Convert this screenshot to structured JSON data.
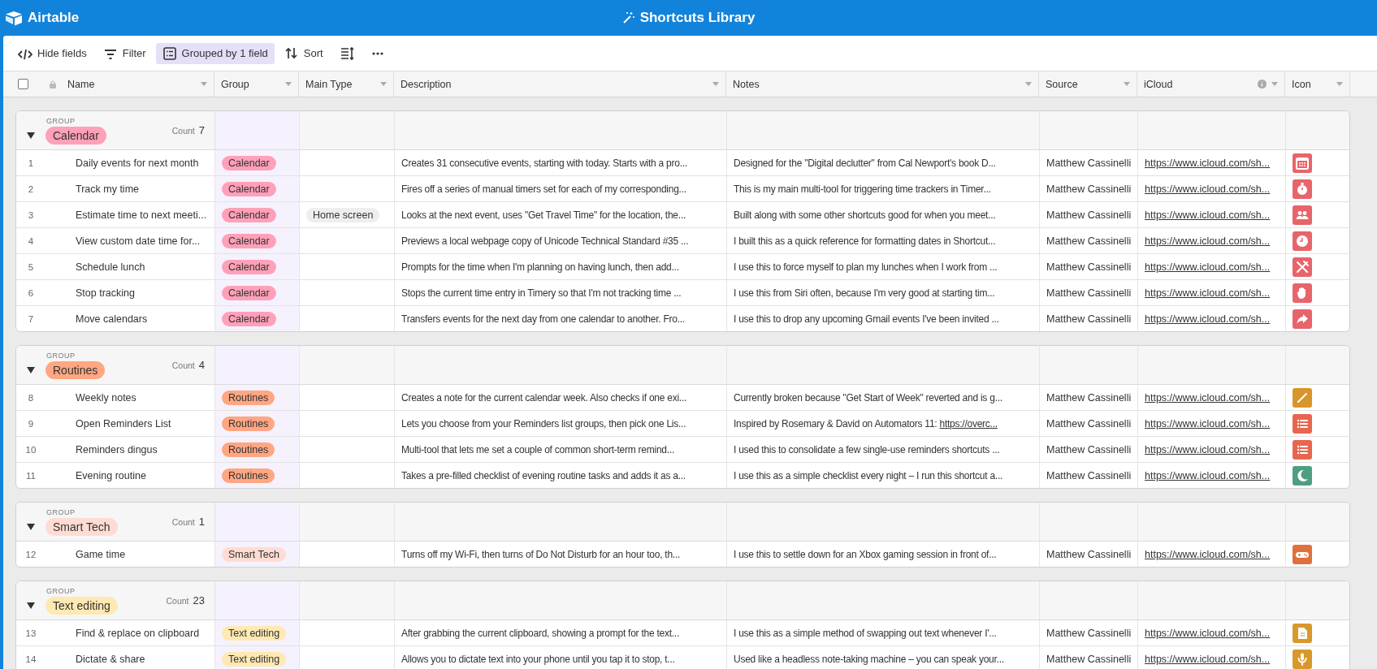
{
  "app": {
    "name": "Airtable"
  },
  "base": {
    "title": "Shortcuts Library"
  },
  "toolbar": [
    {
      "kind": "hide-fields",
      "label": "Hide fields",
      "selected": false
    },
    {
      "kind": "filter",
      "label": "Filter",
      "selected": false
    },
    {
      "kind": "group",
      "label": "Grouped by 1 field",
      "selected": true
    },
    {
      "kind": "sort",
      "label": "Sort",
      "selected": false
    },
    {
      "kind": "row-height",
      "selected": false
    },
    {
      "kind": "more",
      "selected": false
    }
  ],
  "table": {
    "select_all_checked": false,
    "columns": [
      {
        "label": "Name",
        "locked": true,
        "info": false
      },
      {
        "label": "Group",
        "locked": false,
        "info": false
      },
      {
        "label": "Main Type",
        "locked": false,
        "info": false
      },
      {
        "label": "Description",
        "locked": false,
        "info": false
      },
      {
        "label": "Notes",
        "locked": false,
        "info": false
      },
      {
        "label": "Source",
        "locked": false,
        "info": false
      },
      {
        "label": "iCloud",
        "locked": false,
        "info": true
      },
      {
        "label": "Icon",
        "locked": false,
        "info": false
      }
    ]
  },
  "groups": [
    {
      "label": "GROUP",
      "name": "Calendar",
      "color": "#ffa0b9",
      "count_label": "Count",
      "count": "7",
      "expanded": true,
      "rows": [
        {
          "number": "1",
          "name": "Daily events for next month",
          "group": "Calendar",
          "description": "Creates 31 consecutive events, starting with today. Starts with a pro...",
          "notes": "Designed for the \"Digital declutter\" from Cal Newport's book D...",
          "source": "Matthew Cassinelli",
          "icloud": "https://www.icloud.com/sh...",
          "icon": {
            "kind": "calendar",
            "color": "#e8646b"
          }
        },
        {
          "number": "2",
          "name": "Track my time",
          "group": "Calendar",
          "description": "Fires off a series of manual timers set for each of my corresponding...",
          "notes": "This is my main multi-tool for triggering time trackers in Timer...",
          "source": "Matthew Cassinelli",
          "icloud": "https://www.icloud.com/sh...",
          "icon": {
            "kind": "stopwatch",
            "color": "#e8646b"
          }
        },
        {
          "number": "3",
          "name": "Estimate time to next meeti...",
          "group": "Calendar",
          "main_type": "Home screen",
          "description": "Looks at the next event, uses \"Get Travel Time\" for the location, the...",
          "notes": "Built along with some other shortcuts good for when you meet...",
          "source": "Matthew Cassinelli",
          "icloud": "https://www.icloud.com/sh...",
          "icon": {
            "kind": "people",
            "color": "#e8646b"
          }
        },
        {
          "number": "4",
          "name": "View custom date time for...",
          "group": "Calendar",
          "description": "Previews a local webpage copy of Unicode Technical Standard #35 ...",
          "notes": "I built this as a quick reference for formatting dates in Shortcut...",
          "source": "Matthew Cassinelli",
          "icloud": "https://www.icloud.com/sh...",
          "icon": {
            "kind": "clock",
            "color": "#e8646b"
          }
        },
        {
          "number": "5",
          "name": "Schedule lunch",
          "group": "Calendar",
          "description": "Prompts for the time when I'm planning on having lunch, then add...",
          "notes": "I use this to force myself to plan my lunches when I work from ...",
          "source": "Matthew Cassinelli",
          "icloud": "https://www.icloud.com/sh...",
          "icon": {
            "kind": "utensils",
            "color": "#e8646b"
          }
        },
        {
          "number": "6",
          "name": "Stop tracking",
          "group": "Calendar",
          "description": "Stops the current time entry in Timery so that I'm not tracking time ...",
          "notes": "I use this from Siri often, because I'm very good at starting tim...",
          "source": "Matthew Cassinelli",
          "icloud": "https://www.icloud.com/sh...",
          "icon": {
            "kind": "hand",
            "color": "#e8646b"
          }
        },
        {
          "number": "7",
          "name": "Move calendars",
          "group": "Calendar",
          "description": "Transfers events for the next day from one calendar to another. Fro...",
          "notes": "I use this to drop any upcoming Gmail events I've been invited ...",
          "source": "Matthew Cassinelli",
          "icloud": "https://www.icloud.com/sh...",
          "icon": {
            "kind": "arrow",
            "color": "#e8646b"
          }
        }
      ]
    },
    {
      "label": "GROUP",
      "name": "Routines",
      "color": "#ffa682",
      "count_label": "Count",
      "count": "4",
      "expanded": true,
      "rows": [
        {
          "number": "8",
          "name": "Weekly notes",
          "group": "Routines",
          "description": "Creates a note for the current calendar week. Also checks if one exi...",
          "notes": "Currently broken because \"Get Start of Week\" reverted and is g...",
          "source": "Matthew Cassinelli",
          "icloud": "https://www.icloud.com/sh...",
          "icon": {
            "kind": "pencil",
            "color": "#d9952b"
          }
        },
        {
          "number": "9",
          "name": "Open Reminders List",
          "group": "Routines",
          "description": "Lets you choose from your Reminders list groups, then pick one Lis...",
          "notes": "Inspired by Rosemary & David on Automators 11: ",
          "notes_link": "https://overc...",
          "source": "Matthew Cassinelli",
          "icloud": "https://www.icloud.com/sh...",
          "icon": {
            "kind": "list",
            "color": "#e8664f"
          }
        },
        {
          "number": "10",
          "name": "Reminders dingus",
          "group": "Routines",
          "description": "Multi-tool that lets me set a couple of common short-term remind...",
          "notes": "I used this to consolidate a few single-use reminders shortcuts ...",
          "source": "Matthew Cassinelli",
          "icloud": "https://www.icloud.com/sh...",
          "icon": {
            "kind": "list",
            "color": "#e8664f"
          }
        },
        {
          "number": "11",
          "name": "Evening routine",
          "group": "Routines",
          "description": "Takes a pre-filled checklist of evening routine tasks and adds it as a...",
          "notes": "I use this as a simple checklist every night – I run this shortcut a...",
          "source": "Matthew Cassinelli",
          "icloud": "https://www.icloud.com/sh...",
          "icon": {
            "kind": "moon",
            "color": "#4e9f82"
          }
        }
      ]
    },
    {
      "label": "GROUP",
      "name": "Smart Tech",
      "color": "#ffdcd3",
      "count_label": "Count",
      "count": "1",
      "expanded": true,
      "rows": [
        {
          "number": "12",
          "name": "Game time",
          "group": "Smart Tech",
          "description": "Turns off my Wi-Fi, then turns of Do Not Disturb for an hour too, th...",
          "notes": "I use this to settle down for an Xbox gaming session in front of...",
          "source": "Matthew Cassinelli",
          "icloud": "https://www.icloud.com/sh...",
          "icon": {
            "kind": "gamepad",
            "color": "#e0703a"
          }
        }
      ]
    },
    {
      "label": "GROUP",
      "name": "Text editing",
      "color": "#ffe9b3",
      "count_label": "Count",
      "count": "23",
      "expanded": true,
      "rows": [
        {
          "number": "13",
          "name": "Find & replace on clipboard",
          "group": "Text editing",
          "description": "After grabbing the current clipboard, showing a prompt for the text...",
          "notes": "I use this as a simple method of swapping out text whenever I'...",
          "source": "Matthew Cassinelli",
          "icloud": "https://www.icloud.com/sh...",
          "icon": {
            "kind": "document",
            "color": "#d9982b"
          }
        },
        {
          "number": "14",
          "name": "Dictate & share",
          "group": "Text editing",
          "description": "Allows you to dictate text into your phone until you tap it to stop, t...",
          "notes": "Used like a headless note-taking machine – you can speak your...",
          "source": "Matthew Cassinelli",
          "icloud": "https://www.icloud.com/sh...",
          "icon": {
            "kind": "microphone",
            "color": "#d9982b"
          }
        }
      ]
    }
  ]
}
